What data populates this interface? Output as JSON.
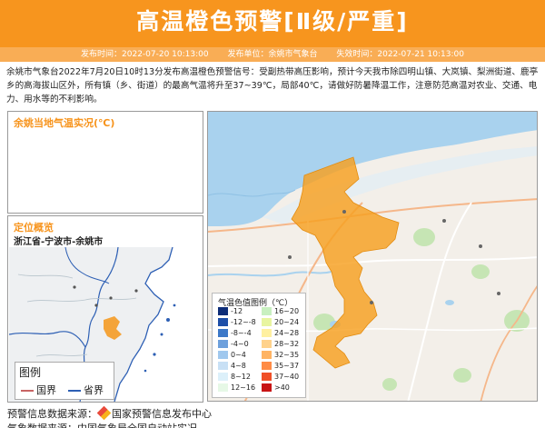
{
  "banner": {
    "title": "高温橙色预警[Ⅱ级/严重]",
    "color": "#f7951e"
  },
  "info": {
    "publish_time": "发布时间：2022-07-20 10:13:00",
    "publisher": "发布单位：余姚市气象台",
    "expire_time": "失效时间：2022-07-21 10:13:00"
  },
  "description": "余姚市气象台2022年7月20日10时13分发布高温橙色预警信号：受副热带高压影响，预计今天我市除四明山镇、大岚镇、梨洲街道、鹿亭乡的高海拔山区外，所有镇（乡、街道）的最高气温将升至37~39℃，局部40℃，请做好防暑降温工作，注意防范高温对农业、交通、电力、用水等的不利影响。",
  "live_panel": {
    "title": "余姚当地气温实况(℃)"
  },
  "locate_panel": {
    "title": "定位概览",
    "location": "浙江省-宁波市-余姚市",
    "legend_title": "图例",
    "legend_items": [
      {
        "label": "国界",
        "color": "#c86464"
      },
      {
        "label": "省界",
        "color": "#2d5fb4"
      }
    ]
  },
  "temp_legend": {
    "title": "气温色值图例（℃）",
    "items": [
      {
        "label": "-12",
        "color": "#0d2d78"
      },
      {
        "label": "16~20",
        "color": "#c8f0c0"
      },
      {
        "label": "-12~-8",
        "color": "#1e4fa8"
      },
      {
        "label": "20~24",
        "color": "#e8f5a0"
      },
      {
        "label": "-8~-4",
        "color": "#3c78c8"
      },
      {
        "label": "24~28",
        "color": "#fff0a0"
      },
      {
        "label": "-4~0",
        "color": "#6ea0dc"
      },
      {
        "label": "28~32",
        "color": "#ffd28c"
      },
      {
        "label": "0~4",
        "color": "#a0c8ee"
      },
      {
        "label": "32~35",
        "color": "#ffb464"
      },
      {
        "label": "4~8",
        "color": "#c8e0f5"
      },
      {
        "label": "35~37",
        "color": "#ff8c46"
      },
      {
        "label": "8~12",
        "color": "#dcf0fa"
      },
      {
        "label": "37~40",
        "color": "#f05028"
      },
      {
        "label": "12~16",
        "color": "#e6f8e6"
      },
      {
        "label": ">40",
        "color": "#c81414"
      }
    ]
  },
  "footer": {
    "source_label": "预警信息数据来源：",
    "source_name": "国家预警信息发布中心",
    "weather_source": "气象数据来源：中国气象局全国自动站实况"
  }
}
